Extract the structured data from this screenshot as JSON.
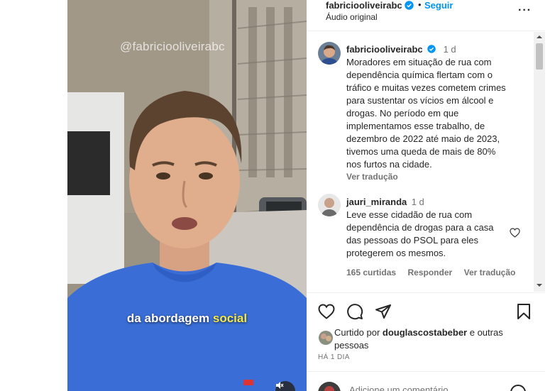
{
  "video": {
    "watermark": "@fabriciooliveirabc",
    "caption_plain": "da abordagem",
    "caption_highlight": "social"
  },
  "header": {
    "username": "fabriciooliveirabc",
    "separator": "•",
    "follow_label": "Seguir",
    "audio_label": "Áudio original",
    "more_label": "···"
  },
  "comments": [
    {
      "username": "fabriciooliveirabc",
      "time": "1 d",
      "verified": true,
      "lines": [
        "Moradores em situação de rua com",
        "dependência química flertam com o",
        "tráfico e muitas vezes cometem crimes",
        "para sustentar os vícios em álcool e",
        "drogas. No período em que",
        "implementamos esse trabalho, de",
        "dezembro de 2022 até maio de 2023,",
        "tivemos uma queda de mais de 80%",
        "nos furtos na cidade."
      ],
      "translate": "Ver tradução"
    },
    {
      "username": "jauri_miranda",
      "time": "1 d",
      "lines": [
        "Leve esse cidadão de rua com",
        "dependência de drogas para a casa",
        "das pessoas do PSOL para eles",
        "protegerem os mesmos."
      ],
      "likes": "165 curtidas",
      "reply": "Responder",
      "translate": "Ver tradução"
    }
  ],
  "liked_by": {
    "prefix": "Curtido por ",
    "user": "douglascostabeber",
    "suffix": " e outras",
    "line2": "pessoas"
  },
  "timestamp": "HÁ 1 DIA",
  "comment_input": {
    "placeholder": "Adicione um comentário..."
  },
  "colors": {
    "accent": "#0095f6",
    "verified": "#0095f6",
    "shirt": "#3a6ed6",
    "caption_highlight": "#f4e84a"
  }
}
